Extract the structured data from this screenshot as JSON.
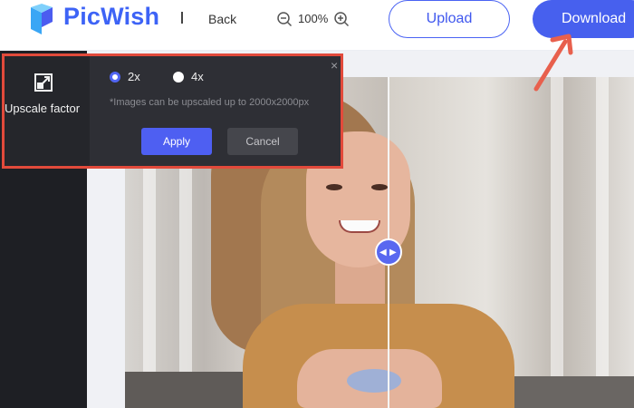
{
  "header": {
    "brand": "PicWish",
    "separator": "I",
    "back_label": "Back",
    "zoom_level": "100%",
    "upload_label": "Upload",
    "download_label": "Download"
  },
  "upscale_panel": {
    "title": "Upscale factor",
    "options": [
      "2x",
      "4x"
    ],
    "selected": "2x",
    "note": "*Images can be upscaled up to 2000x2000px",
    "apply_label": "Apply",
    "cancel_label": "Cancel",
    "close_glyph": "×"
  },
  "compare_handle": {
    "left_glyph": "◀",
    "right_glyph": "▶"
  },
  "colors": {
    "brand_blue": "#3d63f6",
    "accent": "#4760ee",
    "panel_bg": "#2e2f35",
    "annotation_red": "#e24a3b"
  },
  "icons": [
    "picwish-logo-icon",
    "zoom-out-icon",
    "zoom-in-icon",
    "upscale-icon",
    "close-icon",
    "compare-handle-icon",
    "annotation-arrow"
  ]
}
